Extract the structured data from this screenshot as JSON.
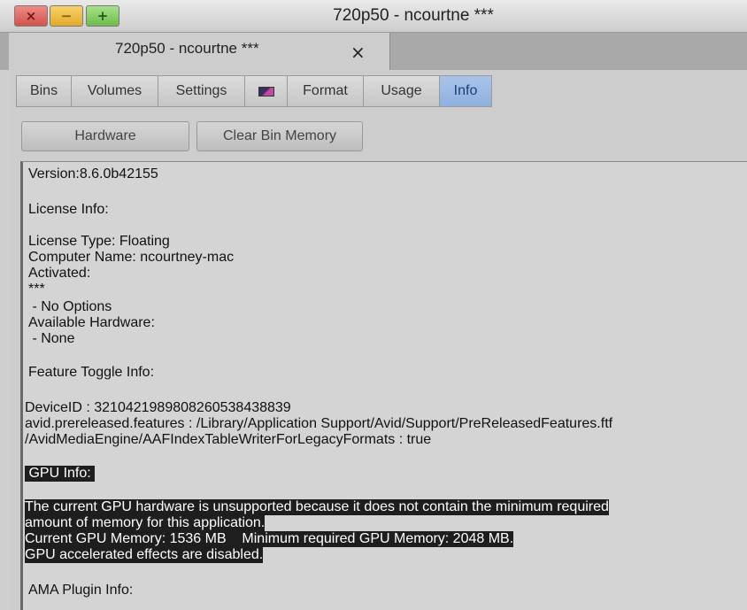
{
  "window": {
    "title": "720p50 - ncourtne ***",
    "close_glyph": "×",
    "minimize_glyph": "−",
    "maximize_glyph": "+"
  },
  "doc_tab": {
    "label": "720p50 - ncourtne ***",
    "close_glyph": "×"
  },
  "tabs": [
    {
      "label": "Bins"
    },
    {
      "label": "Volumes"
    },
    {
      "label": "Settings"
    },
    {
      "label": "",
      "icon": "color-swatch-icon"
    },
    {
      "label": "Format"
    },
    {
      "label": "Usage"
    },
    {
      "label": "Info",
      "active": true
    }
  ],
  "buttons": {
    "hardware": "Hardware",
    "clear_bin_memory": "Clear Bin Memory"
  },
  "info": {
    "version": "Version:8.6.0b42155",
    "license_info": "License Info:",
    "license_type": "License Type: Floating",
    "computer_name": "Computer Name: ncourtney-mac",
    "activated": "Activated:",
    "activated_value": "***",
    "no_options": " - No Options",
    "available_hardware": "Available Hardware:",
    "none": " - None",
    "feature_toggle": "Feature Toggle Info:",
    "device_id": "DeviceID : 3210421989808260538438839",
    "prereleased": "avid.prereleased.features : /Library/Application Support/Avid/Support/PreReleasedFeatures.ftf",
    "aaf_index": "/AvidMediaEngine/AAFIndexTableWriterForLegacyFormats : true",
    "gpu_info": " GPU Info: ",
    "gpu_msg_1": "The current GPU hardware is unsupported because it does not contain the minimum required",
    "gpu_msg_2": "amount of memory for this application.",
    "gpu_msg_3": "Current GPU Memory: 1536 MB    Minimum required GPU Memory: 2048 MB.",
    "gpu_msg_4": "GPU accelerated effects are disabled.",
    "ama_plugin": "AMA Plugin Info:"
  },
  "colors": {
    "active_tab": "#a9c4ea",
    "highlight_bg": "#1e1e1e",
    "close_button": "#d4524c",
    "minimize_button": "#e3aa2a",
    "maximize_button": "#6cbc4c"
  }
}
